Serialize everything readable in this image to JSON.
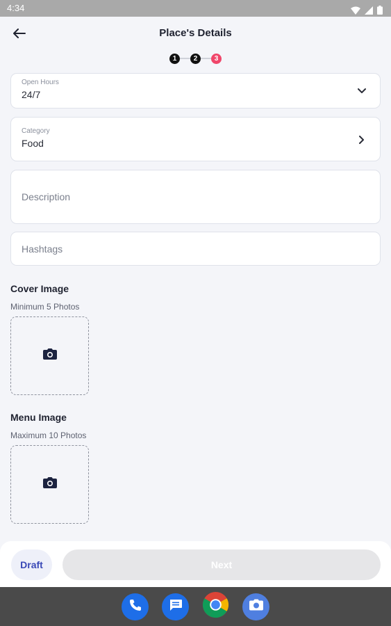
{
  "status_bar": {
    "time": "4:34"
  },
  "header": {
    "title": "Place's Details"
  },
  "stepper": {
    "steps": [
      "1",
      "2",
      "3"
    ],
    "current_step": 3
  },
  "form": {
    "open_hours": {
      "label": "Open Hours",
      "value": "24/7"
    },
    "category": {
      "label": "Category",
      "value": "Food"
    },
    "description": {
      "placeholder": "Description"
    },
    "hashtags": {
      "placeholder": "Hashtags"
    }
  },
  "cover_image": {
    "title": "Cover Image",
    "subtitle": "Minimum 5 Photos"
  },
  "menu_image": {
    "title": "Menu Image",
    "subtitle": "Maximum 10 Photos"
  },
  "actions": {
    "draft_label": "Draft",
    "next_label": "Next"
  },
  "colors": {
    "accent": "#3a49b6",
    "step_current": "#f0466a",
    "next_disabled": "#e6e6e8"
  }
}
